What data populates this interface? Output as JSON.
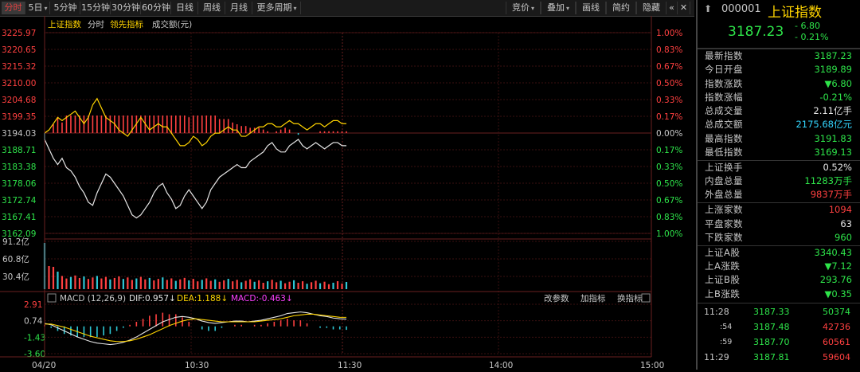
{
  "toolbar": {
    "tabs": [
      {
        "label": "分时",
        "dropdown": false,
        "active": true
      },
      {
        "label": "5日",
        "dropdown": true,
        "active": false
      },
      {
        "label": "5分钟",
        "dropdown": false,
        "active": false
      },
      {
        "label": "15分钟",
        "dropdown": false,
        "active": false
      },
      {
        "label": "30分钟",
        "dropdown": false,
        "active": false
      },
      {
        "label": "60分钟",
        "dropdown": false,
        "active": false
      },
      {
        "label": "日线",
        "dropdown": false,
        "active": false
      },
      {
        "label": "周线",
        "dropdown": false,
        "active": false
      },
      {
        "label": "月线",
        "dropdown": false,
        "active": false
      },
      {
        "label": "更多周期",
        "dropdown": true,
        "active": false
      }
    ],
    "right_tabs": [
      {
        "label": "竞价",
        "dropdown": true
      },
      {
        "label": "叠加",
        "dropdown": true
      },
      {
        "label": "画线",
        "dropdown": false
      },
      {
        "label": "简约",
        "dropdown": false
      },
      {
        "label": "隐藏",
        "dropdown": false
      }
    ],
    "close_icon": "✕",
    "more_icon": "«"
  },
  "chart": {
    "legend": {
      "name": "上证指数",
      "mode": "分时",
      "leading": "领先指标",
      "volume": "成交额(元)"
    },
    "price_ticks": [
      "3225.97",
      "3220.65",
      "3215.32",
      "3210.00",
      "3204.68",
      "3199.35",
      "3194.03",
      "3188.71",
      "3183.38",
      "3178.06",
      "3172.74",
      "3167.41",
      "3162.09"
    ],
    "pct_ticks": [
      "1.00%",
      "0.83%",
      "0.67%",
      "0.50%",
      "0.33%",
      "0.17%",
      "0.00%",
      "0.17%",
      "0.33%",
      "0.50%",
      "0.67%",
      "0.83%",
      "1.00%"
    ],
    "volume_ticks": [
      "91.2亿",
      "60.8亿",
      "30.4亿"
    ],
    "macd": {
      "title": "MACD (12,26,9)",
      "dif": "DIF:0.957↓",
      "dea": "DEA:1.188↓",
      "macd": "MACD:-0.463↓",
      "ticks": [
        "2.91",
        "0.74",
        "-1.43",
        "-3.60"
      ],
      "buttons": [
        "改参数",
        "加指标",
        "换指标"
      ]
    },
    "time_ticks": [
      "04/20",
      "10:30",
      "11:30",
      "14:00",
      "15:00"
    ],
    "colors": {
      "price": "#e6e6e6",
      "leading": "#ffd400",
      "up": "#ff4040",
      "down": "#2ec8d6",
      "dif": "#e6e6e6",
      "dea": "#ffd400"
    }
  },
  "chart_data": {
    "type": "line",
    "prev_close": 3194.03,
    "ylim": [
      3162.09,
      3225.97
    ],
    "price": [
      3192,
      3189,
      3186,
      3184,
      3186,
      3183,
      3182,
      3180,
      3177,
      3175,
      3172,
      3171,
      3175,
      3178,
      3181,
      3180,
      3178,
      3176,
      3174,
      3171,
      3168,
      3167,
      3168,
      3170,
      3172,
      3175,
      3177,
      3178,
      3175,
      3173,
      3170,
      3171,
      3174,
      3176,
      3174,
      3172,
      3170,
      3172,
      3176,
      3178,
      3180,
      3181,
      3182,
      3183,
      3184,
      3183,
      3183,
      3185,
      3186,
      3187,
      3188,
      3190,
      3191,
      3189,
      3188,
      3188,
      3190,
      3191,
      3192,
      3190,
      3189,
      3190,
      3191,
      3190,
      3189,
      3190,
      3191,
      3191,
      3190,
      3190
    ],
    "leading": [
      3194,
      3195,
      3197,
      3199,
      3198,
      3199,
      3200,
      3201,
      3199,
      3197,
      3199,
      3203,
      3205,
      3202,
      3199,
      3198,
      3197,
      3195,
      3194,
      3193,
      3195,
      3197,
      3199,
      3197,
      3195,
      3196,
      3197,
      3196,
      3196,
      3194,
      3192,
      3190,
      3190,
      3191,
      3193,
      3192,
      3190,
      3191,
      3193,
      3194,
      3194,
      3195,
      3196,
      3195,
      3195,
      3193,
      3193,
      3194,
      3195,
      3196,
      3196,
      3197,
      3197,
      3196,
      3196,
      3197,
      3198,
      3197,
      3197,
      3196,
      3195,
      3196,
      3197,
      3197,
      3196,
      3197,
      3198,
      3198,
      3197,
      3197
    ],
    "volume_series_name": "成交额",
    "macd_ylim": [
      -3.6,
      2.91
    ],
    "dif": [
      0.4,
      0.2,
      -0.2,
      -0.6,
      -1.0,
      -1.4,
      -1.7,
      -2.0,
      -2.2,
      -2.3,
      -2.4,
      -2.3,
      -2.1,
      -1.8,
      -1.4,
      -0.9,
      -0.4,
      0.1,
      0.6,
      0.9,
      1.2,
      1.3,
      1.2,
      1.0,
      0.7,
      0.5,
      0.4,
      0.5,
      0.6,
      0.7,
      0.7,
      0.6,
      0.7,
      0.8,
      1.0,
      1.2,
      1.4,
      1.7,
      1.8,
      1.9,
      1.8,
      1.6,
      1.4,
      1.3,
      1.1,
      1.0,
      0.96
    ],
    "dea": [
      0.3,
      0.3,
      0.1,
      -0.1,
      -0.4,
      -0.7,
      -1.0,
      -1.3,
      -1.5,
      -1.7,
      -1.9,
      -2.0,
      -2.0,
      -1.9,
      -1.7,
      -1.4,
      -1.1,
      -0.7,
      -0.3,
      0.1,
      0.4,
      0.7,
      0.9,
      1.0,
      0.9,
      0.8,
      0.7,
      0.6,
      0.6,
      0.6,
      0.6,
      0.6,
      0.6,
      0.7,
      0.8,
      0.9,
      1.0,
      1.2,
      1.4,
      1.5,
      1.6,
      1.6,
      1.5,
      1.4,
      1.3,
      1.2,
      1.19
    ]
  },
  "quote": {
    "code": "000001",
    "name": "上证指数",
    "price": "3187.23",
    "change": "- 6.80",
    "change_pct": "- 0.21%",
    "rows": [
      {
        "label": "最新指数",
        "value": "3187.23",
        "color": "g"
      },
      {
        "label": "今日开盘",
        "value": "3189.89",
        "color": "g"
      },
      {
        "label": "指数涨跌",
        "value": "▼6.80",
        "color": "g"
      },
      {
        "label": "指数涨幅",
        "value": "-0.21%",
        "color": "g"
      },
      {
        "label": "总成交量",
        "value": "2.11亿手",
        "color": "w"
      },
      {
        "label": "总成交额",
        "value": "2175.68亿元",
        "color": "c"
      },
      {
        "label": "最高指数",
        "value": "3191.83",
        "color": "g"
      },
      {
        "label": "最低指数",
        "value": "3169.13",
        "color": "g"
      }
    ],
    "rows2": [
      {
        "label": "上证换手",
        "value": "0.52%",
        "color": "w"
      },
      {
        "label": "内盘总量",
        "value": "11283万手",
        "color": "g"
      },
      {
        "label": "外盘总量",
        "value": "9837万手",
        "color": "r"
      }
    ],
    "rows3": [
      {
        "label": "上涨家数",
        "value": "1094",
        "color": "r"
      },
      {
        "label": "平盘家数",
        "value": "63",
        "color": "w"
      },
      {
        "label": "下跌家数",
        "value": "960",
        "color": "g"
      }
    ],
    "rows4": [
      {
        "label": "上证A股",
        "value": "3340.43",
        "color": "g"
      },
      {
        "label": "上A涨跌",
        "value": "▼7.12",
        "color": "g"
      },
      {
        "label": "上证B股",
        "value": "293.76",
        "color": "g"
      },
      {
        "label": "上B涨跌",
        "value": "▼0.35",
        "color": "g"
      }
    ],
    "ticks": [
      {
        "time": "11:28",
        "price": "3187.33",
        "vol": "50374",
        "color": "g"
      },
      {
        "time": ":54",
        "price": "3187.48",
        "vol": "42736",
        "color": "r"
      },
      {
        "time": ":59",
        "price": "3187.70",
        "vol": "60561",
        "color": "r"
      },
      {
        "time": "11:29",
        "price": "3187.81",
        "vol": "59604",
        "color": "r"
      }
    ]
  }
}
